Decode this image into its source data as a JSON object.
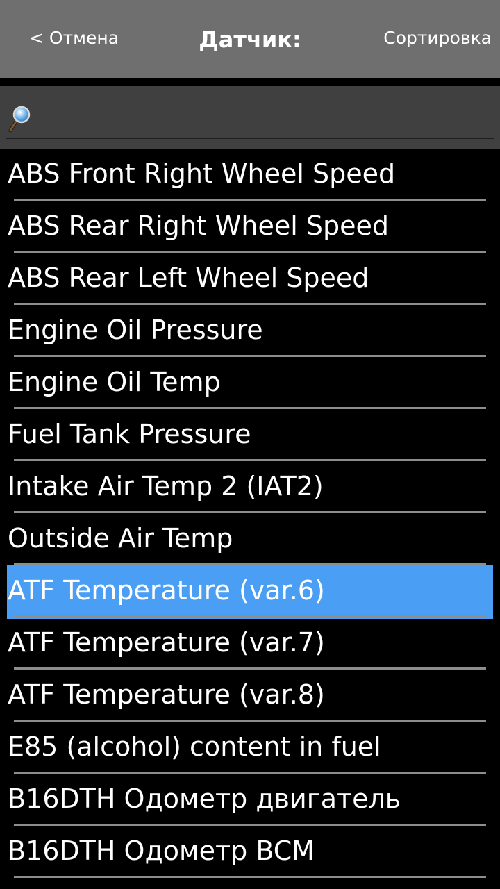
{
  "header": {
    "cancel_label": "< Отмена",
    "title": "Датчик:",
    "sort_label": "Сортировка"
  },
  "search": {
    "value": "",
    "placeholder": ""
  },
  "sensors": [
    {
      "label": "ABS Front Right Wheel Speed",
      "selected": false
    },
    {
      "label": "ABS Rear Right Wheel Speed",
      "selected": false
    },
    {
      "label": "ABS Rear Left Wheel Speed",
      "selected": false
    },
    {
      "label": "Engine Oil Pressure",
      "selected": false
    },
    {
      "label": "Engine Oil Temp",
      "selected": false
    },
    {
      "label": "Fuel Tank Pressure",
      "selected": false
    },
    {
      "label": "Intake Air Temp 2 (IAT2)",
      "selected": false
    },
    {
      "label": "Outside Air Temp",
      "selected": false
    },
    {
      "label": "ATF Temperature (var.6)",
      "selected": true
    },
    {
      "label": "ATF Temperature (var.7)",
      "selected": false
    },
    {
      "label": "ATF Temperature (var.8)",
      "selected": false
    },
    {
      "label": "E85 (alcohol) content in fuel",
      "selected": false
    },
    {
      "label": "B16DTH Одометр двигатель",
      "selected": false
    },
    {
      "label": "B16DTH Одометр BCM",
      "selected": false
    }
  ],
  "colors": {
    "header_bg": "#6f6f6f",
    "search_bg": "#404040",
    "list_bg": "#000000",
    "selected_bg": "#4a9ff4",
    "divider": "#8d8d8d",
    "text": "#ffffff"
  },
  "icons": {
    "search": "magnifier-icon"
  }
}
